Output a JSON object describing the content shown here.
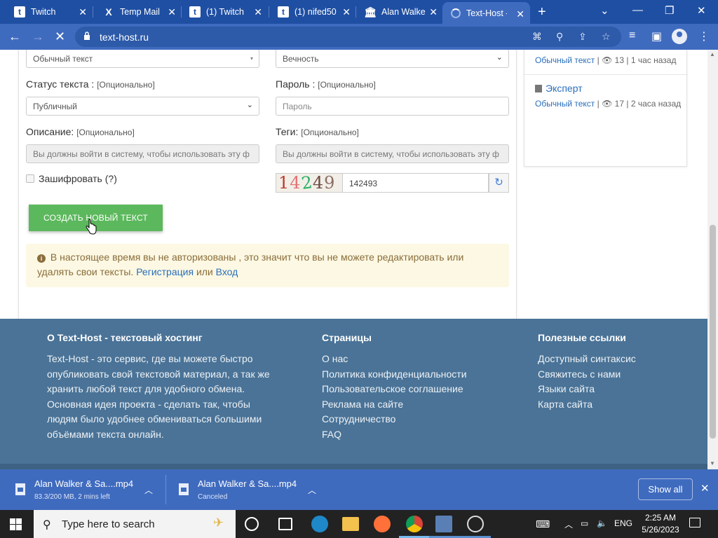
{
  "browser": {
    "tabs": [
      {
        "title": "Twitch",
        "icon": "twitch-icon"
      },
      {
        "title": "Temp Mail",
        "icon": "x-icon"
      },
      {
        "title": "(1) Twitch",
        "icon": "twitch-icon"
      },
      {
        "title": "(1) nifed50",
        "icon": "twitch-icon"
      },
      {
        "title": "Alan Walke",
        "icon": "bank-icon"
      },
      {
        "title": "Text-Host -",
        "icon": "loading-spinner-icon"
      }
    ],
    "active_tab_index": 5,
    "url": "text-host.ru",
    "accent_color": "#3f6bbf"
  },
  "form": {
    "format_select_value": "Обычный текст",
    "expiry_select_value": "Вечность",
    "status_label": "Статус текста :",
    "status_optional": "[Опционально]",
    "status_select_value": "Публичный",
    "password_label": "Пароль :",
    "password_optional": "[Опционально]",
    "password_placeholder": "Пароль",
    "description_label": "Описание:",
    "description_optional": "[Опционально]",
    "description_placeholder": "Вы должны войти в систему, чтобы использовать эту ф",
    "tags_label": "Теги:",
    "tags_optional": "[Опционально]",
    "tags_placeholder": "Вы должны войти в систему, чтобы использовать эту ф",
    "encrypt_label": "Зашифровать",
    "encrypt_help": "(?)",
    "captcha_value": "142493",
    "create_button": "СОЗДАТЬ НОВЫЙ ТЕКСТ",
    "alert_text": "В настоящее время вы не авторизованы , это значит что вы не можете редактировать или удалять свои тексты.",
    "alert_register": "Регистрация",
    "alert_or": "или",
    "alert_login": "Вход"
  },
  "sidebar": {
    "items": [
      {
        "category": "Обычный текст",
        "views": "13",
        "time": "1 час назад"
      },
      {
        "title": "Эксперт",
        "category": "Обычный текст",
        "views": "17",
        "time": "2 часа назад"
      }
    ]
  },
  "footer": {
    "about_heading": "О Text-Host - текстовый хостинг",
    "about_text": "Text-Host - это сервис, где вы можете быстро опубликовать свой текстовой материал, а так же хранить любой текст для удобного обмена. Основная идея проекта - сделать так, чтобы людям было удобнее обмениваться большими объёмами текста онлайн.",
    "pages_heading": "Страницы",
    "pages": [
      "О нас",
      "Политика конфиденциальности",
      "Пользовательское соглашение",
      "Реклама на сайте",
      "Сотрудничество",
      "FAQ"
    ],
    "links_heading": "Полезные ссылки",
    "links": [
      "Доступный синтаксис",
      "Свяжитесь с нами",
      "Языки сайта",
      "Карта сайта"
    ],
    "color": "#4a7397"
  },
  "downloads": {
    "items": [
      {
        "name": "Alan Walker & Sa....mp4",
        "status": "83.3/200 MB, 2 mins left"
      },
      {
        "name": "Alan Walker & Sa....mp4",
        "status": "Canceled"
      }
    ],
    "show_all": "Show all"
  },
  "taskbar": {
    "search_placeholder": "Type here to search",
    "language": "ENG",
    "time": "2:25 AM",
    "date": "5/26/2023"
  }
}
